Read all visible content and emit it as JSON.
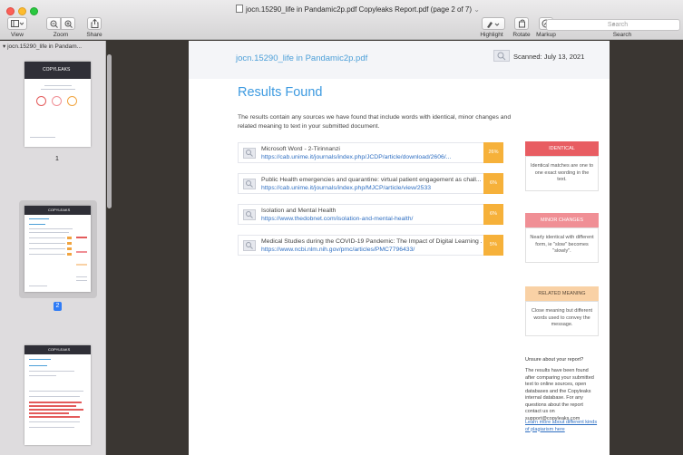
{
  "window": {
    "title": "jocn.15290_life in Pandamic2p.pdf Copyleaks Report.pdf (page 2 of 7)",
    "title_chevron": "⌄"
  },
  "toolbar": {
    "view_label": "View",
    "zoom_label": "Zoom",
    "share_label": "Share",
    "highlight_label": "Highlight",
    "rotate_label": "Rotate",
    "markup_label": "Markup",
    "search_placeholder": "Search",
    "search_label": "Search"
  },
  "sidebar": {
    "header": "jocn.15290_life in Pandam...",
    "pages": [
      {
        "number": "1",
        "selected": false
      },
      {
        "number": "2",
        "selected": true
      },
      {
        "number": "3",
        "selected": false
      }
    ],
    "thumb_brand": "COPYLEAKS"
  },
  "document": {
    "file_name": "jocn.15290_life in Pandamic2p.pdf",
    "scanned": "Scanned: July 13, 2021",
    "results_title": "Results Found",
    "intro": "The results contain any sources we have found that include words with identical, minor changes and related meaning to text in your submitted document.",
    "results": [
      {
        "title": "Microsoft Word - 2-Tirinnanzi",
        "url": "https://cab.unime.it/journals/index.php/JCDP/article/download/2606/...",
        "percent": "26%"
      },
      {
        "title": "Public Health emergencies and quarantine: virtual patient engagement as chall...",
        "url": "https://cab.unime.it/journals/index.php/MJCP/article/view/2533",
        "percent": "6%"
      },
      {
        "title": "Isolation and Mental Health",
        "url": "https://www.thedobnet.com/isolation-and-mental-health/",
        "percent": "6%"
      },
      {
        "title": "Medical Studies during the COVID-19 Pandemic: The Impact of Digital Learning ...",
        "url": "https://www.ncbi.nlm.nih.gov/pmc/articles/PMC7796433/",
        "percent": "5%"
      }
    ],
    "legend": [
      {
        "heading": "IDENTICAL",
        "description": "Identical matches are one to one exact wording in the text.",
        "color": "#e85d62",
        "text_color": "#ffffff"
      },
      {
        "heading": "MINOR CHANGES",
        "description": "Nearly identical with different form, ie \"slow\" becomes \"slowly\".",
        "color": "#f08f95",
        "text_color": "#ffffff"
      },
      {
        "heading": "RELATED MEANING",
        "description": "Close meaning but different words used to convey the message.",
        "color": "#f9d1a5",
        "text_color": "#5a4a3a"
      }
    ],
    "unsure_heading": "Unsure about your report?",
    "unsure_body": "The results have been found after comparing your submitted text to online sources, open databases and the Copyleaks internal database. For any questions about the report contact us on support@copyleaks.com",
    "unsure_link": "Learn more about different kinds of plagiarism here"
  },
  "colors": {
    "accent_blue": "#3d9ae0",
    "percent_orange": "#f6b13a",
    "selection_blue": "#2f7cf6"
  }
}
